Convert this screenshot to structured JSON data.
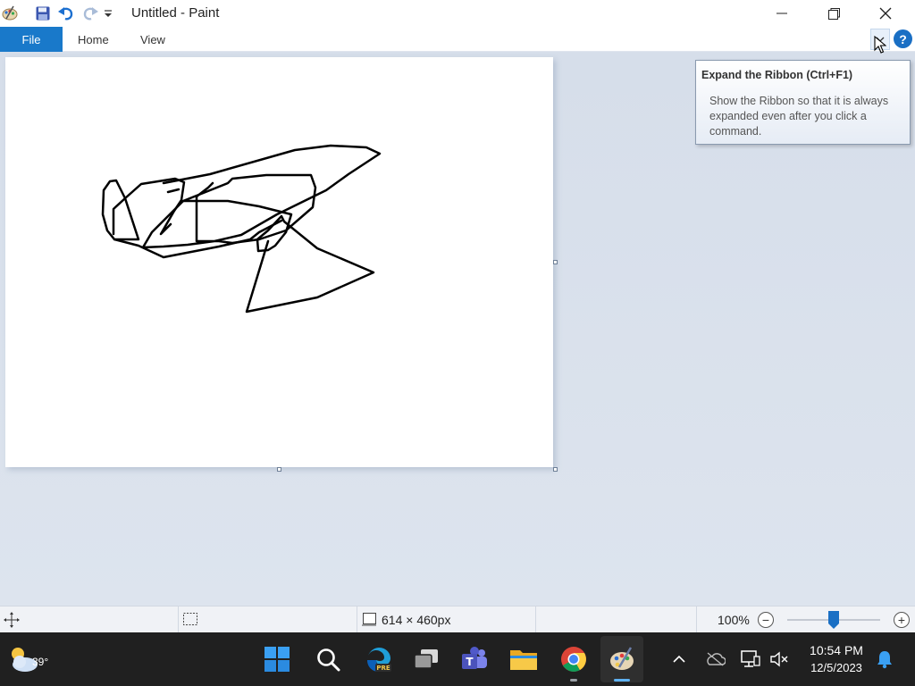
{
  "window": {
    "title": "Untitled - Paint",
    "buttons": [
      "minimize",
      "restore",
      "close"
    ]
  },
  "quick_access": {
    "icons": [
      "paint-app-icon",
      "save-icon",
      "undo-icon",
      "redo-icon",
      "customize-dropdown-icon"
    ]
  },
  "ribbon": {
    "tabs": [
      {
        "label": "File",
        "active": true
      },
      {
        "label": "Home",
        "active": false
      },
      {
        "label": "View",
        "active": false
      }
    ],
    "expand_button_icon": "chevron-down-icon",
    "help_label": "?"
  },
  "tooltip": {
    "title": "Expand the Ribbon (Ctrl+F1)",
    "body": "Show the Ribbon so that it is always expanded even after you click a command."
  },
  "status_bar": {
    "canvas_size": "614 × 460px",
    "zoom": "100%",
    "zoom_minus": "−",
    "zoom_plus": "+",
    "zoom_level": 0.5
  },
  "taskbar": {
    "weather_temp": "39°",
    "time": "10:54 PM",
    "date": "12/5/2023",
    "apps": [
      "start-icon",
      "search-icon",
      "edge-pre-icon",
      "task-view-icon",
      "teams-icon",
      "file-explorer-icon",
      "chrome-icon",
      "paint-icon"
    ],
    "tray": [
      "chevron-up-icon",
      "onedrive-icon",
      "network-icon",
      "volume-muted-icon",
      "notification-bell-icon"
    ]
  },
  "colors": {
    "accent": "#1979ca",
    "taskbar_bg": "#202020",
    "workspace_bg": "#d8e0ec"
  }
}
